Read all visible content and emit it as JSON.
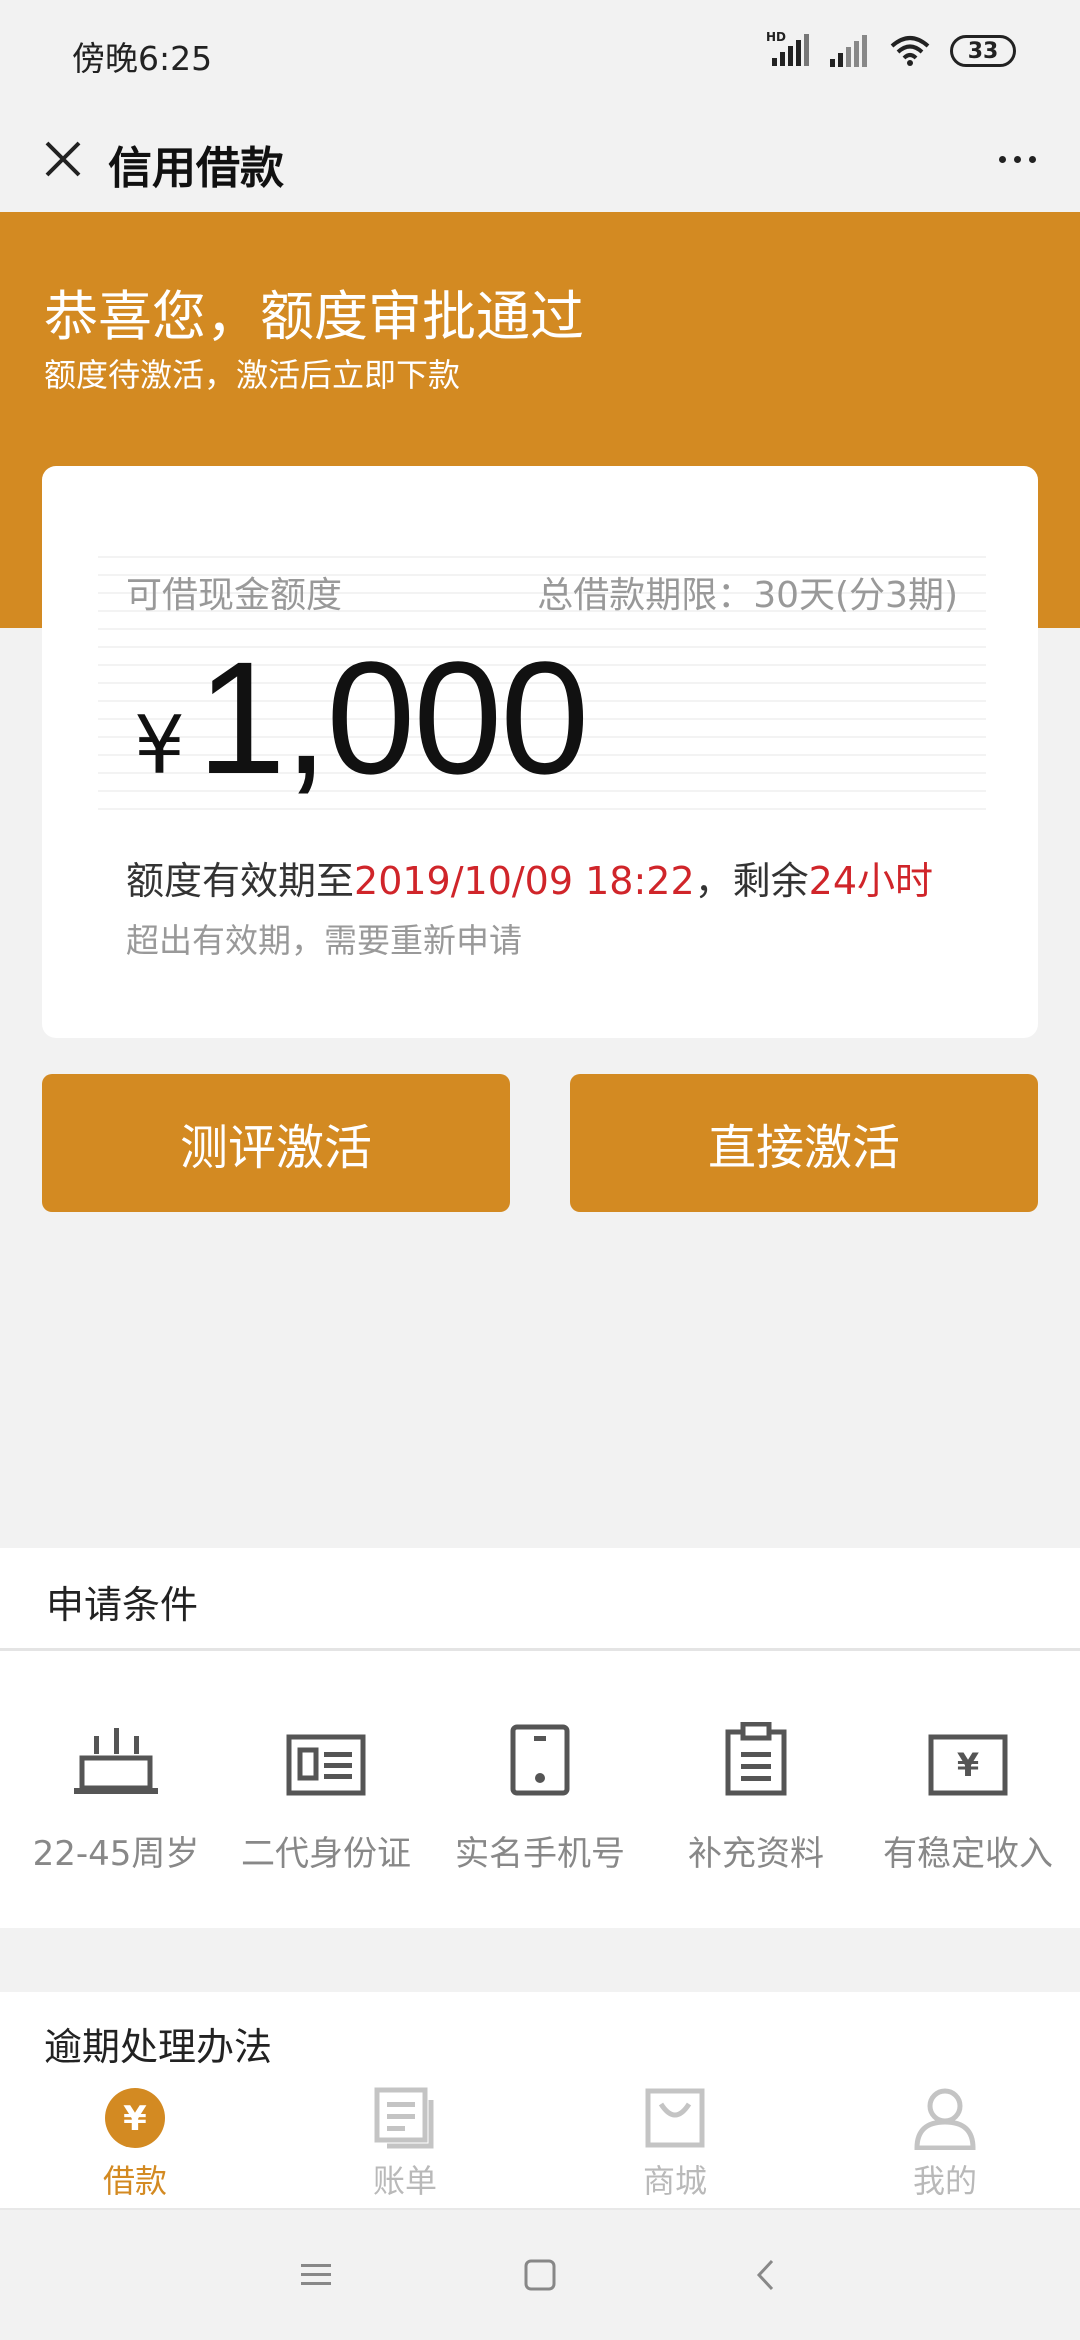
{
  "status_bar": {
    "time": "傍晚6:25",
    "network_badge": "HD",
    "battery": "33"
  },
  "nav": {
    "title": "信用借款",
    "close_icon": "close-icon",
    "more_icon": "more-icon"
  },
  "banner": {
    "title": "恭喜您，额度审批通过",
    "subtitle": "额度待激活，激活后立即下款",
    "background_color": "#d38a22"
  },
  "card": {
    "limit_label": "可借现金额度",
    "term_label": "总借款期限：30天(分3期)",
    "currency": "¥",
    "amount": "1,000",
    "validity_prefix": "额度有效期至",
    "validity_date": "2019/10/09 18:22",
    "validity_mid": "，剩余",
    "validity_remaining": "24小时",
    "expire_note": "超出有效期，需要重新申请",
    "highlight_color": "#d0252a"
  },
  "buttons": {
    "eval_activate": "测评激活",
    "direct_activate": "直接激活"
  },
  "conditions": {
    "title": "申请条件",
    "items": [
      {
        "label": "22-45周岁",
        "icon": "birthday-cake-icon"
      },
      {
        "label": "二代身份证",
        "icon": "id-card-icon"
      },
      {
        "label": "实名手机号",
        "icon": "phone-icon"
      },
      {
        "label": "补充资料",
        "icon": "clipboard-icon"
      },
      {
        "label": "有稳定收入",
        "icon": "income-icon"
      }
    ]
  },
  "overdue": {
    "title": "逾期处理办法"
  },
  "tabs": [
    {
      "label": "借款",
      "icon": "loan-icon",
      "active": true
    },
    {
      "label": "账单",
      "icon": "bill-icon",
      "active": false
    },
    {
      "label": "商城",
      "icon": "shop-icon",
      "active": false
    },
    {
      "label": "我的",
      "icon": "profile-icon",
      "active": false
    }
  ],
  "system_nav": {
    "menu": "menu-icon",
    "home": "home-icon",
    "back": "back-icon"
  }
}
